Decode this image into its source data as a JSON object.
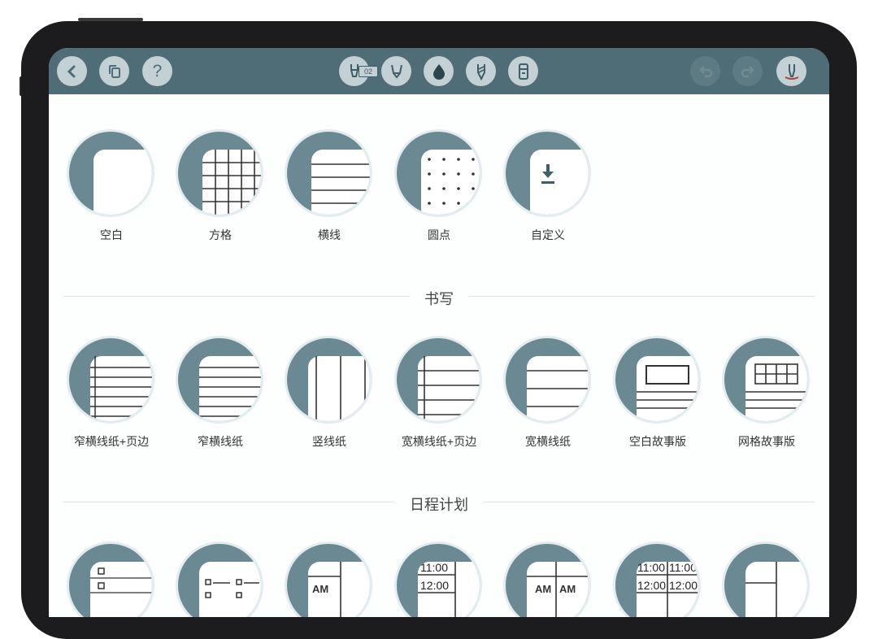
{
  "toolbar": {
    "left_buttons": [
      {
        "name": "back-button",
        "icon": "chevron-left-icon"
      },
      {
        "name": "duplicate-button",
        "icon": "copy-icon"
      },
      {
        "name": "help-button",
        "icon": "question-icon",
        "glyph": "?"
      }
    ],
    "center_tools": [
      {
        "name": "pen-tool",
        "icon": "fountain-pen-icon",
        "badge": "02"
      },
      {
        "name": "highlighter-tool",
        "icon": "highlighter-icon"
      },
      {
        "name": "ink-color-tool",
        "icon": "ink-drop-icon"
      },
      {
        "name": "pencil-tool",
        "icon": "pencil-icon"
      },
      {
        "name": "eraser-tool",
        "icon": "eraser-icon"
      }
    ],
    "right_buttons": [
      {
        "name": "undo-button",
        "icon": "undo-icon"
      },
      {
        "name": "redo-button",
        "icon": "redo-icon"
      },
      {
        "name": "pen-settings-button",
        "icon": "pen-settings-icon"
      }
    ]
  },
  "templates": {
    "basic": [
      "空白",
      "方格",
      "横线",
      "圆点",
      "自定义"
    ],
    "writing_title": "书写",
    "writing": [
      "窄横线纸+页边",
      "窄横线纸",
      "竖线纸",
      "宽横线纸+页边",
      "宽横线纸",
      "空白故事版",
      "网格故事版"
    ],
    "planner_title": "日程计划",
    "planner_texts": {
      "am": "AM",
      "t1": "11:00",
      "t2": "12:00"
    }
  },
  "colors": {
    "toolbar": "#4f6d77",
    "thumb": "#6a8992",
    "accent": "#3f5e68"
  }
}
